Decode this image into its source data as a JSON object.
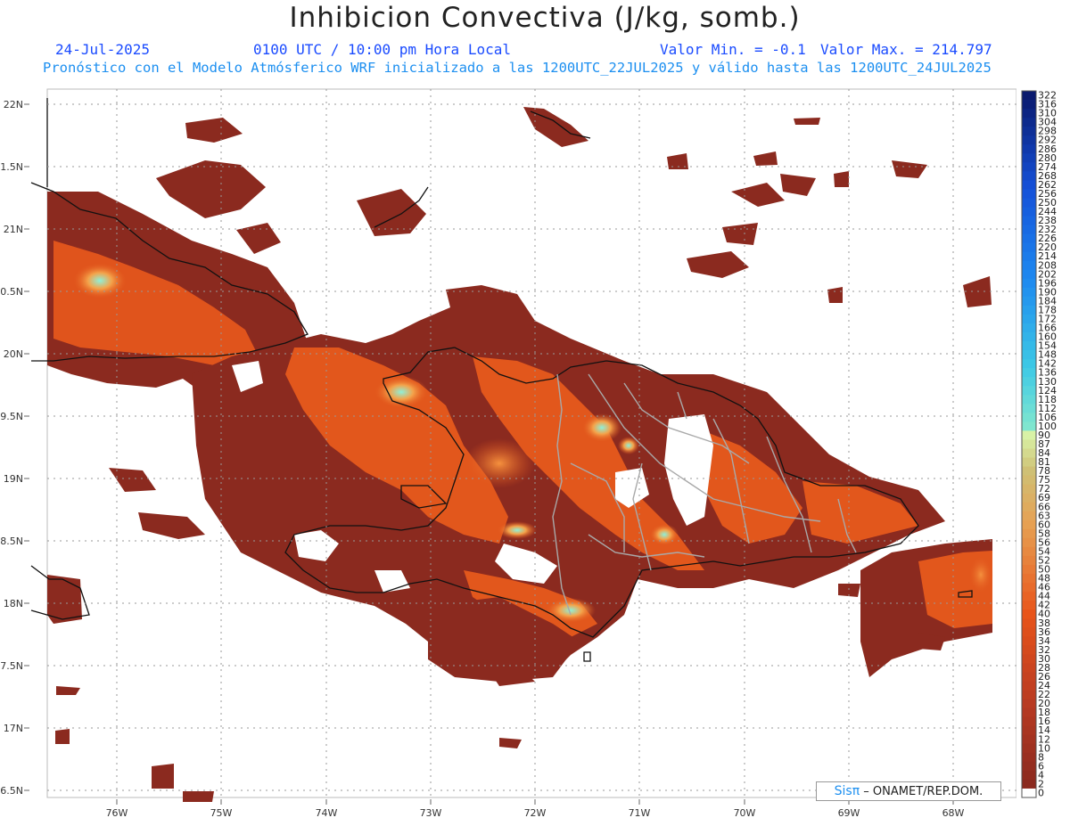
{
  "header": {
    "title": "Inhibicion Convectiva (J/kg, somb.)",
    "date": "24-Jul-2025",
    "time": "0100 UTC / 10:00 pm Hora Local",
    "value_min": "Valor Min. = -0.1",
    "value_max": "Valor Max. = 214.797",
    "subtitle": "Pronóstico con el Modelo Atmósferico WRF inicializado a las 1200UTC_22JUL2025 y válido hasta las  1200UTC_24JUL2025"
  },
  "map": {
    "lat_labels": [
      "22N",
      "21.5N",
      "21N",
      "20.5N",
      "20N",
      "19.5N",
      "19N",
      "18.5N",
      "18N",
      "17.5N",
      "17N",
      "16.5N"
    ],
    "lon_labels": [
      "76W",
      "75W",
      "74W",
      "73W",
      "72W",
      "71W",
      "70W",
      "69W",
      "68W"
    ],
    "grid": true
  },
  "legend": {
    "labels": [
      "322",
      "316",
      "310",
      "304",
      "298",
      "292",
      "286",
      "280",
      "274",
      "268",
      "262",
      "256",
      "250",
      "244",
      "238",
      "232",
      "226",
      "220",
      "214",
      "208",
      "202",
      "196",
      "190",
      "184",
      "178",
      "172",
      "166",
      "160",
      "154",
      "148",
      "142",
      "136",
      "130",
      "124",
      "118",
      "112",
      "106",
      "100",
      "90",
      "87",
      "84",
      "81",
      "78",
      "75",
      "72",
      "69",
      "66",
      "63",
      "60",
      "58",
      "56",
      "54",
      "52",
      "50",
      "48",
      "46",
      "44",
      "42",
      "40",
      "38",
      "36",
      "34",
      "32",
      "30",
      "28",
      "26",
      "24",
      "22",
      "20",
      "18",
      "16",
      "14",
      "12",
      "10",
      "8",
      "6",
      "4",
      "2",
      "0"
    ]
  },
  "credit": {
    "logo": "Sisπ",
    "text": "– ONAMET/REP.DOM."
  },
  "colors": {
    "dark_red": "#8b2a1f",
    "orange": "#e2571c",
    "light_orange": "#f08a3a",
    "cyan": "#7fe6cf",
    "dark_blue": "#0a1a6e"
  }
}
